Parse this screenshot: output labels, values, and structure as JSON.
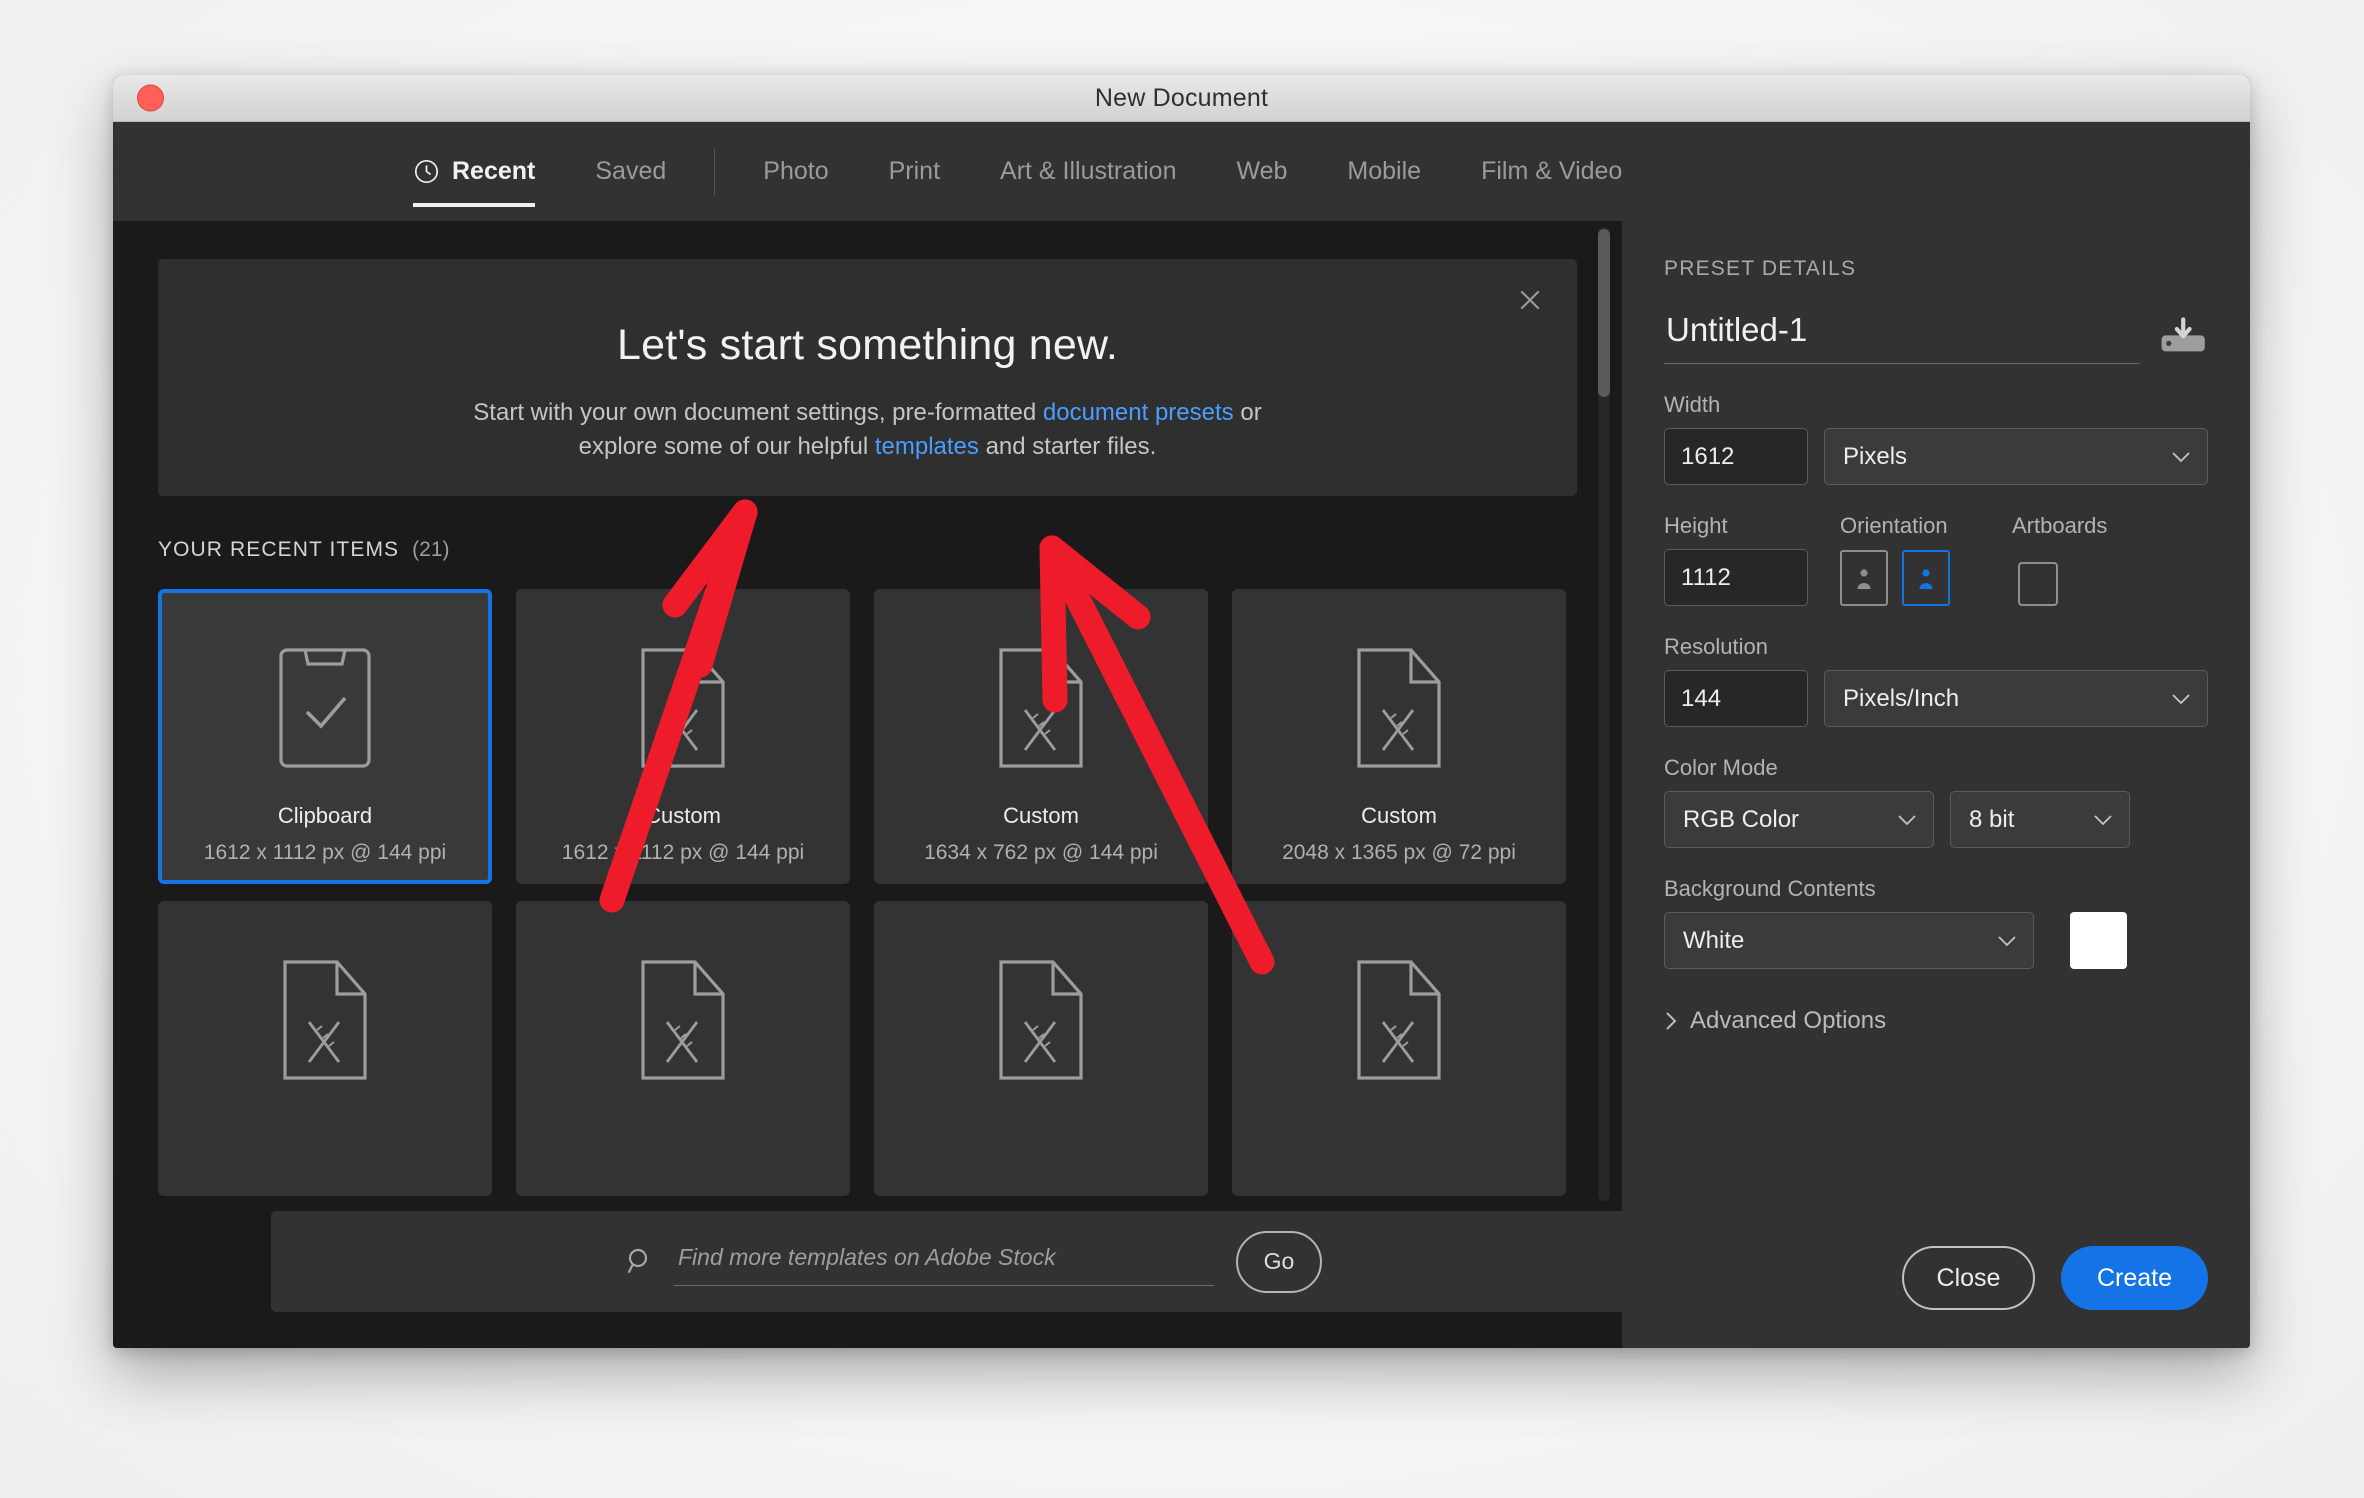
{
  "window": {
    "title": "New Document",
    "close_button": "close-window"
  },
  "tabs": [
    {
      "label": "Recent",
      "icon": "clock-icon",
      "active": true
    },
    {
      "label": "Saved",
      "active": false
    },
    {
      "label": "Photo",
      "active": false
    },
    {
      "label": "Print",
      "active": false
    },
    {
      "label": "Art & Illustration",
      "active": false
    },
    {
      "label": "Web",
      "active": false
    },
    {
      "label": "Mobile",
      "active": false
    },
    {
      "label": "Film & Video",
      "active": false
    }
  ],
  "banner": {
    "title": "Let's start something new.",
    "line1_before": "Start with your own document settings, pre-formatted ",
    "line1_link": "document presets",
    "line1_after": " or",
    "line2_before": "explore some of our helpful ",
    "line2_link": "templates",
    "line2_after": " and starter files.",
    "close_icon": "close-icon"
  },
  "recent": {
    "title": "YOUR RECENT ITEMS",
    "count": "(21)",
    "items": [
      {
        "name": "Clipboard",
        "meta": "1612 x 1112 px @ 144 ppi",
        "icon": "clipboard-icon",
        "selected": true
      },
      {
        "name": "Custom",
        "meta": "1612 x 1112 px @ 144 ppi",
        "icon": "document-icon",
        "selected": false
      },
      {
        "name": "Custom",
        "meta": "1634 x 762 px @ 144 ppi",
        "icon": "document-icon",
        "selected": false
      },
      {
        "name": "Custom",
        "meta": "2048 x 1365 px @ 72 ppi",
        "icon": "document-icon",
        "selected": false
      },
      {
        "name": "",
        "meta": "",
        "icon": "document-icon",
        "selected": false
      },
      {
        "name": "",
        "meta": "",
        "icon": "document-icon",
        "selected": false
      },
      {
        "name": "",
        "meta": "",
        "icon": "document-icon",
        "selected": false
      },
      {
        "name": "",
        "meta": "",
        "icon": "document-icon",
        "selected": false
      }
    ]
  },
  "search": {
    "placeholder": "Find more templates on Adobe Stock",
    "value": "",
    "go_label": "Go",
    "icon": "search-icon"
  },
  "preset": {
    "section_label": "PRESET DETAILS",
    "name_value": "Untitled-1",
    "save_preset_icon": "save-preset-icon",
    "width_label": "Width",
    "width_value": "1612",
    "width_unit": "Pixels",
    "height_label": "Height",
    "height_value": "1112",
    "orientation_label": "Orientation",
    "orientation_portrait": "portrait-icon",
    "orientation_landscape": "landscape-icon",
    "orientation_selected": "landscape",
    "artboards_label": "Artboards",
    "artboards_checked": false,
    "resolution_label": "Resolution",
    "resolution_value": "144",
    "resolution_unit": "Pixels/Inch",
    "colormode_label": "Color Mode",
    "colormode_value": "RGB Color",
    "bitdepth_value": "8 bit",
    "background_label": "Background Contents",
    "background_value": "White",
    "background_swatch": "#ffffff",
    "advanced_label": "Advanced Options"
  },
  "footer": {
    "close_label": "Close",
    "create_label": "Create"
  },
  "colors": {
    "accent": "#1473e6",
    "annotation": "#ee1c2a",
    "panel_bg": "#323232",
    "content_bg": "#1a1a1a",
    "card_bg": "#333333"
  },
  "annotations": [
    {
      "name": "arrow-to-document-presets",
      "color": "#ee1c2a"
    },
    {
      "name": "arrow-to-templates",
      "color": "#ee1c2a"
    }
  ]
}
